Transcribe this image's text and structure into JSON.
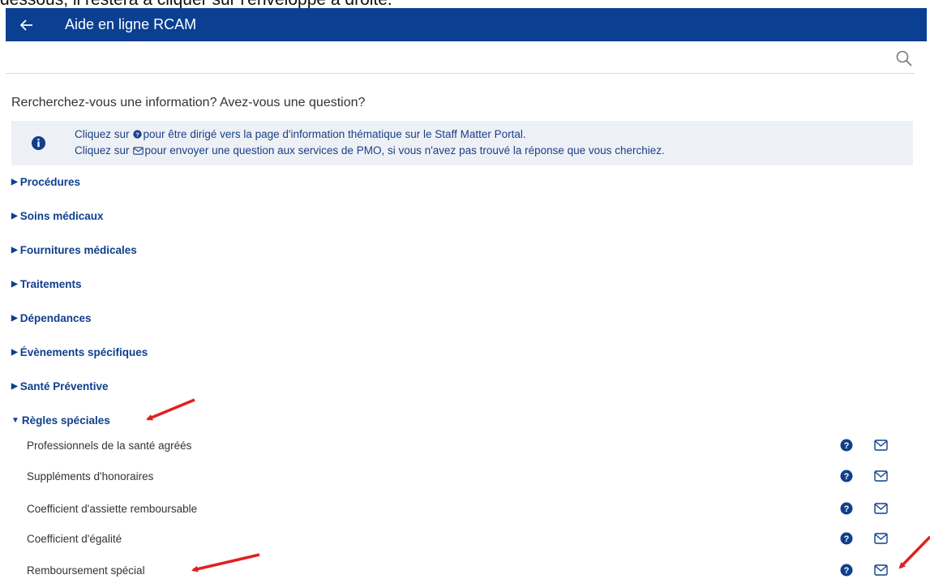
{
  "caption": "dessous, il restera à cliquer sur l'enveloppe à droite.",
  "header": {
    "title": "Aide en ligne RCAM",
    "back_icon": "arrow-left-icon"
  },
  "search": {
    "icon": "search-icon"
  },
  "question": "Rercherchez-vous une information? Avez-vous une question?",
  "info": {
    "line1_prefix": "Cliquez sur",
    "line1_suffix": "pour être dirigé vers la page d'information thématique sur le Staff Matter Portal.",
    "line2_prefix": "Cliquez sur",
    "line2_suffix": "pour envoyer une question aux services de PMO, si vous n'avez pas trouvé la réponse que vous cherchiez."
  },
  "categories": [
    {
      "label": "Procédures",
      "expanded": false
    },
    {
      "label": "Soins médicaux",
      "expanded": false
    },
    {
      "label": "Fournitures médicales",
      "expanded": false
    },
    {
      "label": "Traitements",
      "expanded": false
    },
    {
      "label": "Dépendances",
      "expanded": false
    },
    {
      "label": "Évènements spécifiques",
      "expanded": false
    },
    {
      "label": "Santé Préventive",
      "expanded": false
    },
    {
      "label": "Règles spéciales",
      "expanded": true
    }
  ],
  "special_rules_items": [
    "Professionnels de la santé agréés",
    "Suppléments d'honoraires",
    "Coefficient d'assiette remboursable",
    "Coefficient d'égalité",
    "Remboursement spécial"
  ],
  "colors": {
    "header_bg": "#0a3f91",
    "link": "#0f3f8c",
    "info_bg": "#edf1f6",
    "annotation": "#e0201e"
  }
}
